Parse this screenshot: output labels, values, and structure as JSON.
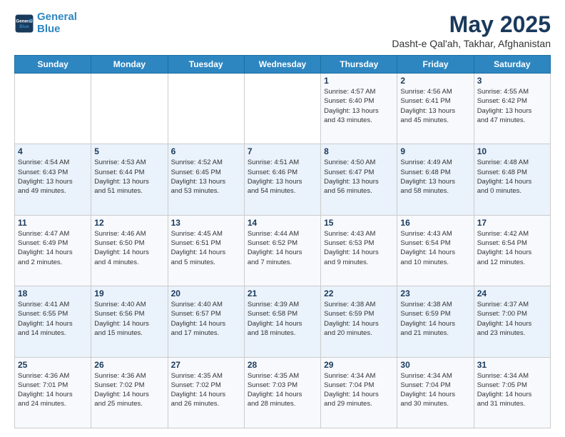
{
  "logo": {
    "line1": "General",
    "line2": "Blue"
  },
  "title": "May 2025",
  "subtitle": "Dasht-e Qal'ah, Takhar, Afghanistan",
  "days_of_week": [
    "Sunday",
    "Monday",
    "Tuesday",
    "Wednesday",
    "Thursday",
    "Friday",
    "Saturday"
  ],
  "weeks": [
    [
      {
        "day": "",
        "detail": ""
      },
      {
        "day": "",
        "detail": ""
      },
      {
        "day": "",
        "detail": ""
      },
      {
        "day": "",
        "detail": ""
      },
      {
        "day": "1",
        "detail": "Sunrise: 4:57 AM\nSunset: 6:40 PM\nDaylight: 13 hours\nand 43 minutes."
      },
      {
        "day": "2",
        "detail": "Sunrise: 4:56 AM\nSunset: 6:41 PM\nDaylight: 13 hours\nand 45 minutes."
      },
      {
        "day": "3",
        "detail": "Sunrise: 4:55 AM\nSunset: 6:42 PM\nDaylight: 13 hours\nand 47 minutes."
      }
    ],
    [
      {
        "day": "4",
        "detail": "Sunrise: 4:54 AM\nSunset: 6:43 PM\nDaylight: 13 hours\nand 49 minutes."
      },
      {
        "day": "5",
        "detail": "Sunrise: 4:53 AM\nSunset: 6:44 PM\nDaylight: 13 hours\nand 51 minutes."
      },
      {
        "day": "6",
        "detail": "Sunrise: 4:52 AM\nSunset: 6:45 PM\nDaylight: 13 hours\nand 53 minutes."
      },
      {
        "day": "7",
        "detail": "Sunrise: 4:51 AM\nSunset: 6:46 PM\nDaylight: 13 hours\nand 54 minutes."
      },
      {
        "day": "8",
        "detail": "Sunrise: 4:50 AM\nSunset: 6:47 PM\nDaylight: 13 hours\nand 56 minutes."
      },
      {
        "day": "9",
        "detail": "Sunrise: 4:49 AM\nSunset: 6:48 PM\nDaylight: 13 hours\nand 58 minutes."
      },
      {
        "day": "10",
        "detail": "Sunrise: 4:48 AM\nSunset: 6:48 PM\nDaylight: 14 hours\nand 0 minutes."
      }
    ],
    [
      {
        "day": "11",
        "detail": "Sunrise: 4:47 AM\nSunset: 6:49 PM\nDaylight: 14 hours\nand 2 minutes."
      },
      {
        "day": "12",
        "detail": "Sunrise: 4:46 AM\nSunset: 6:50 PM\nDaylight: 14 hours\nand 4 minutes."
      },
      {
        "day": "13",
        "detail": "Sunrise: 4:45 AM\nSunset: 6:51 PM\nDaylight: 14 hours\nand 5 minutes."
      },
      {
        "day": "14",
        "detail": "Sunrise: 4:44 AM\nSunset: 6:52 PM\nDaylight: 14 hours\nand 7 minutes."
      },
      {
        "day": "15",
        "detail": "Sunrise: 4:43 AM\nSunset: 6:53 PM\nDaylight: 14 hours\nand 9 minutes."
      },
      {
        "day": "16",
        "detail": "Sunrise: 4:43 AM\nSunset: 6:54 PM\nDaylight: 14 hours\nand 10 minutes."
      },
      {
        "day": "17",
        "detail": "Sunrise: 4:42 AM\nSunset: 6:54 PM\nDaylight: 14 hours\nand 12 minutes."
      }
    ],
    [
      {
        "day": "18",
        "detail": "Sunrise: 4:41 AM\nSunset: 6:55 PM\nDaylight: 14 hours\nand 14 minutes."
      },
      {
        "day": "19",
        "detail": "Sunrise: 4:40 AM\nSunset: 6:56 PM\nDaylight: 14 hours\nand 15 minutes."
      },
      {
        "day": "20",
        "detail": "Sunrise: 4:40 AM\nSunset: 6:57 PM\nDaylight: 14 hours\nand 17 minutes."
      },
      {
        "day": "21",
        "detail": "Sunrise: 4:39 AM\nSunset: 6:58 PM\nDaylight: 14 hours\nand 18 minutes."
      },
      {
        "day": "22",
        "detail": "Sunrise: 4:38 AM\nSunset: 6:59 PM\nDaylight: 14 hours\nand 20 minutes."
      },
      {
        "day": "23",
        "detail": "Sunrise: 4:38 AM\nSunset: 6:59 PM\nDaylight: 14 hours\nand 21 minutes."
      },
      {
        "day": "24",
        "detail": "Sunrise: 4:37 AM\nSunset: 7:00 PM\nDaylight: 14 hours\nand 23 minutes."
      }
    ],
    [
      {
        "day": "25",
        "detail": "Sunrise: 4:36 AM\nSunset: 7:01 PM\nDaylight: 14 hours\nand 24 minutes."
      },
      {
        "day": "26",
        "detail": "Sunrise: 4:36 AM\nSunset: 7:02 PM\nDaylight: 14 hours\nand 25 minutes."
      },
      {
        "day": "27",
        "detail": "Sunrise: 4:35 AM\nSunset: 7:02 PM\nDaylight: 14 hours\nand 26 minutes."
      },
      {
        "day": "28",
        "detail": "Sunrise: 4:35 AM\nSunset: 7:03 PM\nDaylight: 14 hours\nand 28 minutes."
      },
      {
        "day": "29",
        "detail": "Sunrise: 4:34 AM\nSunset: 7:04 PM\nDaylight: 14 hours\nand 29 minutes."
      },
      {
        "day": "30",
        "detail": "Sunrise: 4:34 AM\nSunset: 7:04 PM\nDaylight: 14 hours\nand 30 minutes."
      },
      {
        "day": "31",
        "detail": "Sunrise: 4:34 AM\nSunset: 7:05 PM\nDaylight: 14 hours\nand 31 minutes."
      }
    ]
  ]
}
